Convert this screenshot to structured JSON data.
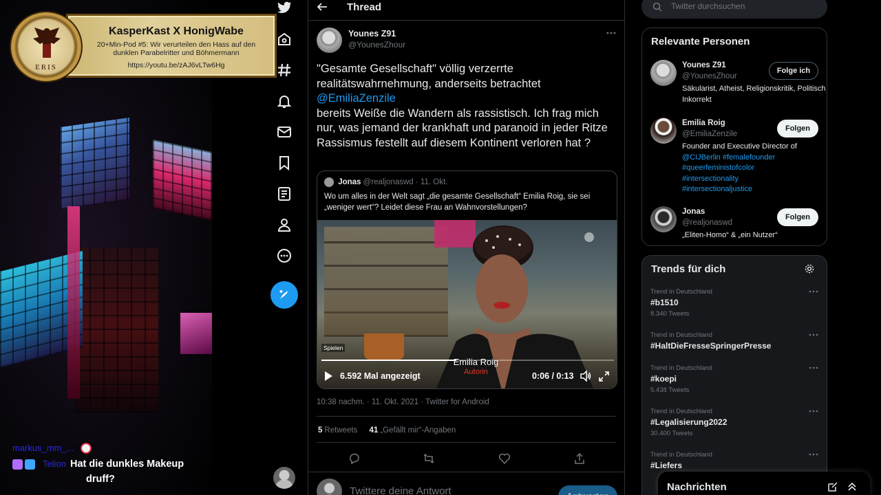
{
  "overlay": {
    "banner": {
      "logo_text": "ERIS",
      "title": "KasperKast X HonigWabe",
      "subtitle_line1": "20+Min-Pod #5: Wir verurteilen den Hass auf den",
      "subtitle_line2": "dunklen Parabelritter und Böhmermann",
      "url": "https://youtu.be/zAJ6vLTw6Hg"
    },
    "chat": {
      "line1_user": "markus_mm_...",
      "line2_user": "Telion",
      "line2_message_a": "Hat die dunkles Makeup",
      "line2_message_b": "druff?"
    }
  },
  "nav": {
    "icons": [
      "twitter-logo",
      "home",
      "explore-hashtag",
      "notifications-bell",
      "messages-envelope",
      "bookmarks",
      "lists",
      "profile",
      "more-circle",
      "compose-tweet",
      "account-avatar"
    ]
  },
  "thread": {
    "title": "Thread",
    "author_name": "Younes Z91",
    "author_handle": "@YounesZhour",
    "text_part1": "\"Gesamte Gesellschaft\" völlig verzerrte realitätswahrnehmung, anderseits betrachtet",
    "mention": "@EmiliaZenzile",
    "text_part2": "bereits Weiße die Wandern als rassistisch. Ich frag mich nur, was jemand der krankhaft und paranoid in jeder Ritze Rassismus festellt  auf diesem Kontinent verloren hat ?",
    "quote": {
      "name": "Jonas",
      "handle_date": "@realjonaswd · 11. Okt.",
      "text": "Wo um alles in der Welt sagt „die gesamte Gesellschaft“ Emilia Roig, sie sei „weniger wert“? Leidet diese Frau an Wahnvorstellungen?",
      "video": {
        "caption_name": "Emilia Roig",
        "caption_role": "Autorin",
        "play_label": "Spielen",
        "views": "6.592 Mal angezeigt",
        "time": "0:06 / 0:13",
        "progress": 0.46
      }
    },
    "meta": "10:38 nachm. · 11. Okt. 2021 · Twitter for Android",
    "retweets_count": "5",
    "retweets_label": "Retweets",
    "likes_count": "41",
    "likes_label": "„Gefällt mir“-Angaben",
    "reply_placeholder": "Twittere deine Antwort",
    "reply_button": "Antworten"
  },
  "sidebar": {
    "search_placeholder": "Twitter durchsuchen",
    "people_title": "Relevante Personen",
    "people": [
      {
        "name": "Younes Z91",
        "handle": "@YounesZhour",
        "button": "Folge ich",
        "bio": "Säkularist, Atheist, Religionskritik, Politisch Inkorrekt"
      },
      {
        "name": "Emilia Roig",
        "handle": "@EmiliaZenzile",
        "button": "Folgen",
        "bio": "Founder and Executive Director of",
        "links": [
          "@CIJBerlin #femalefounder",
          "#queerfeministofcolor",
          "#intersectionality",
          "#intersectionaljustice"
        ]
      },
      {
        "name": "Jonas",
        "handle": "@realjonaswd",
        "button": "Folgen",
        "bio": "„Eliten-Homo“ & „ein Nutzer“"
      }
    ],
    "trends_title": "Trends für dich",
    "trends": [
      {
        "context": "Trend in Deutschland",
        "name": "#b1510",
        "count": "8.340 Tweets"
      },
      {
        "context": "Trend in Deutschland",
        "name": "#HaltDieFresseSpringerPresse",
        "count": ""
      },
      {
        "context": "Trend in Deutschland",
        "name": "#koepi",
        "count": "5.438 Tweets"
      },
      {
        "context": "Trend in Deutschland",
        "name": "#Legalisierung2022",
        "count": "30.400 Tweets"
      },
      {
        "context": "Trend in Deutschland",
        "name": "#Liefers",
        "count": ""
      }
    ],
    "messages_title": "Nachrichten"
  },
  "colors": {
    "accent": "#1d9bf0",
    "background": "#000000",
    "border": "#2f3336",
    "muted_text": "#71767b"
  }
}
